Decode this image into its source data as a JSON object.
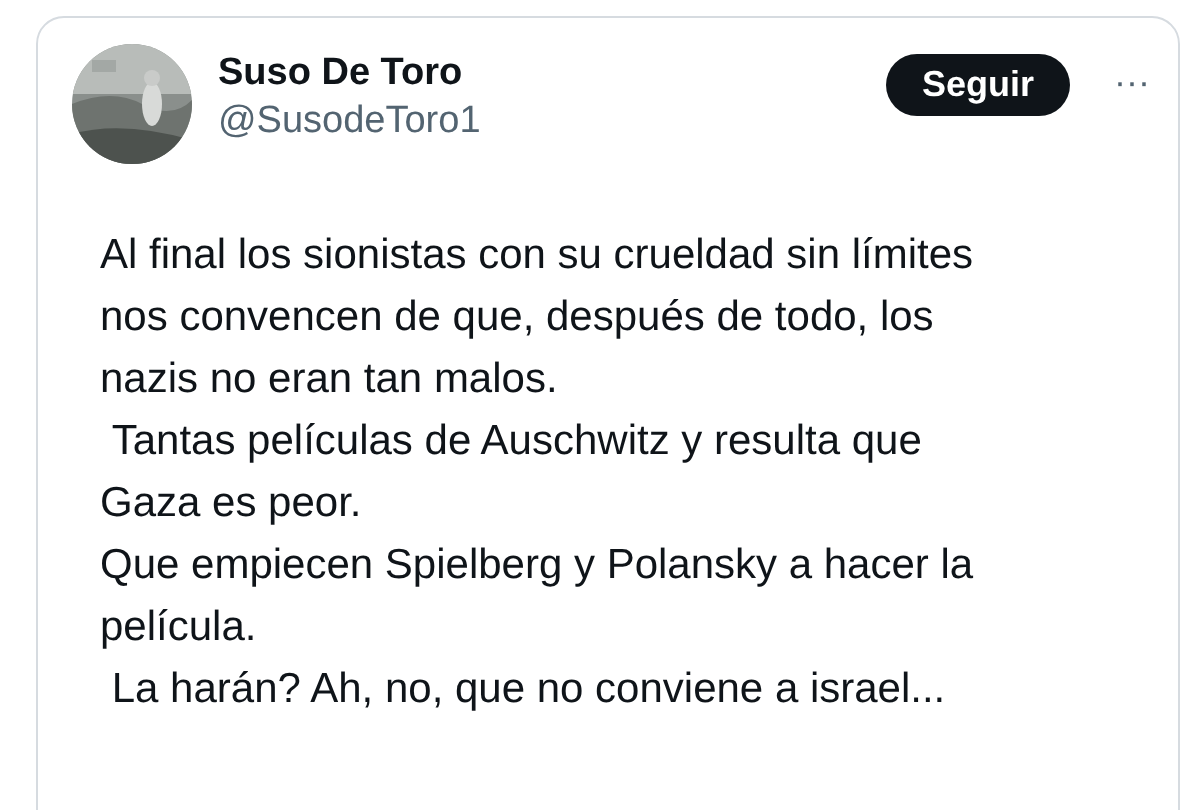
{
  "author": {
    "name": "Suso De Toro",
    "handle": "@SusodeToro1"
  },
  "follow_button": {
    "label": "Seguir"
  },
  "more_button": {
    "label": "···"
  },
  "paragraphs": [
    "Al final los sionistas con su crueldad sin límites\nnos convencen de que, después de todo, los\nnazis no eran tan malos.",
    " Tantas películas de Auschwitz y resulta que\nGaza es peor.",
    "Que empiecen Spielberg y Polansky a hacer la\npelícula.",
    " La harán? Ah, no, que no conviene a israel..."
  ]
}
